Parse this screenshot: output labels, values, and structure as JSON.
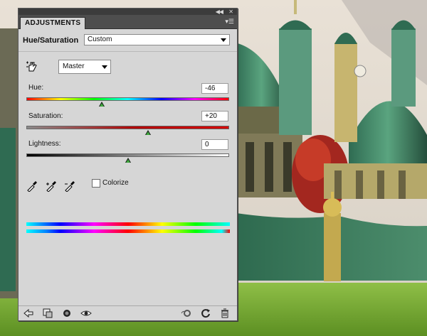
{
  "panel": {
    "tab_label": "ADJUSTMENTS",
    "adjustment_title": "Hue/Saturation",
    "preset_value": "Custom",
    "channel_value": "Master"
  },
  "sliders": {
    "hue": {
      "label": "Hue:",
      "value": "-46",
      "level": 0.372
    },
    "saturation": {
      "label": "Saturation:",
      "value": "+20",
      "level": 0.6
    },
    "lightness": {
      "label": "Lightness:",
      "value": "0",
      "level": 0.5
    }
  },
  "colorize": {
    "label": "Colorize",
    "checked": false
  },
  "icons": {
    "hand": "on-image-adjust-hand-icon",
    "eyedropper": "eyedropper-icon",
    "eyedropper_add": "eyedropper-add-icon",
    "eyedropper_subtract": "eyedropper-subtract-icon",
    "back": "back-arrow-icon",
    "clip": "clip-to-layer-icon",
    "visibility_circle": "toggle-layer-visibility-icon",
    "eye": "eye-icon",
    "reset_previous": "view-previous-state-icon",
    "reset": "reset-icon",
    "trash": "trash-icon"
  },
  "colors": {
    "panel_bg": "#d6d6d6",
    "tabrow_bg": "#4e4e4e",
    "thumb_fill": "#3ea73e"
  }
}
